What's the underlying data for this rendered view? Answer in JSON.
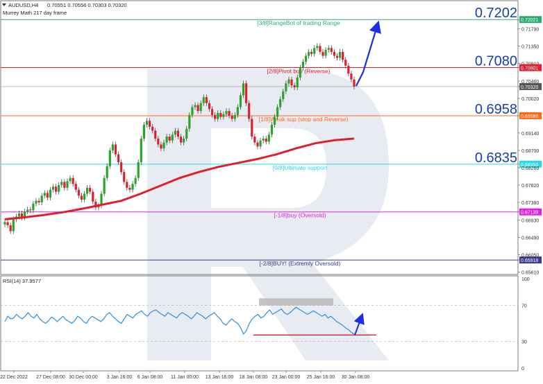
{
  "chart_data": {
    "type": "candlestick",
    "header": {
      "symbol": "AUDUSD,H4",
      "ohlc": "0.70551 0.70556 0.70303 0.70320",
      "indicator": "Murrey Math 217 day frame"
    },
    "ylim": [
      0.6555,
      0.725
    ],
    "y_ticks": [
      "0.72021",
      "0.71790",
      "0.71350",
      "0.70910",
      "0.70801",
      "0.70460",
      "0.70320",
      "0.70020",
      "0.69580",
      "0.69140",
      "0.68700",
      "0.68350",
      "0.68260",
      "0.67820",
      "0.67380",
      "0.67139",
      "0.66930",
      "0.66490",
      "0.66050",
      "0.65918",
      "0.65610"
    ],
    "highlight_ticks": {
      "0.72021": "#2eaa6e",
      "0.70801": "#e01e2d",
      "0.70320": "#555555",
      "0.69580": "#ff6a1a",
      "0.68350": "#2ad9e8",
      "0.67139": "#e020e0",
      "0.65918": "#3a3a8c"
    },
    "x_ticks": [
      "22 Dec 2022",
      "27 Dec 08:00",
      "30 Dec 00:00",
      "3 Jan 16:00",
      "6 Jan 08:00",
      "11 Jan 00:00",
      "13 Jan 16:00",
      "18 Jan 08:00",
      "23 Jan 00:00",
      "25 Jan 16:00",
      "30 Jan 08:00"
    ],
    "levels": [
      {
        "price": 0.72021,
        "color": "#2eaa6e",
        "label": "[3/8]RangeBot of trading Range",
        "big": "0.7202"
      },
      {
        "price": 0.70801,
        "color": "#e01e2d",
        "label": "[2/8]Pivot buy (Reverse)",
        "big": "0.7080"
      },
      {
        "price": 0.6958,
        "color": "#ff6a1a",
        "label": "[1/8]Weak sup (stop and Reverse)",
        "big": "0.6958"
      },
      {
        "price": 0.6835,
        "color": "#2ad9e8",
        "label": "[0/8]Ultimate support",
        "big": "0.6835"
      },
      {
        "price": 0.67139,
        "color": "#e020e0",
        "label": "[-1/8]buy (Oversold)",
        "big": ""
      },
      {
        "price": 0.65918,
        "color": "#3a3a8c",
        "label": "[-2/8]BUY! (Extremly Oversold)",
        "big": ""
      }
    ],
    "close_series": [
      0.6688,
      0.668,
      0.6665,
      0.6695,
      0.6702,
      0.671,
      0.67,
      0.6715,
      0.672,
      0.6718,
      0.6735,
      0.6742,
      0.6738,
      0.6755,
      0.6762,
      0.675,
      0.677,
      0.6778,
      0.6765,
      0.6782,
      0.679,
      0.6775,
      0.6792,
      0.68,
      0.6785,
      0.677,
      0.6755,
      0.6745,
      0.676,
      0.6775,
      0.6765,
      0.674,
      0.6725,
      0.673,
      0.676,
      0.68,
      0.683,
      0.687,
      0.6885,
      0.686,
      0.684,
      0.6815,
      0.679,
      0.6775,
      0.677,
      0.6785,
      0.68,
      0.684,
      0.69,
      0.6935,
      0.6945,
      0.693,
      0.692,
      0.69,
      0.6885,
      0.6875,
      0.689,
      0.6905,
      0.6895,
      0.691,
      0.692,
      0.6905,
      0.689,
      0.69,
      0.6925,
      0.696,
      0.698,
      0.6985,
      0.697,
      0.699,
      0.7005,
      0.699,
      0.6975,
      0.696,
      0.695,
      0.6965,
      0.6955,
      0.6962,
      0.697,
      0.6958,
      0.695,
      0.696,
      0.698,
      0.701,
      0.704,
      0.699,
      0.695,
      0.6905,
      0.689,
      0.688,
      0.6895,
      0.69,
      0.6892,
      0.691,
      0.6935,
      0.6955,
      0.698,
      0.7,
      0.702,
      0.704,
      0.705,
      0.7035,
      0.703,
      0.7055,
      0.708,
      0.7095,
      0.711,
      0.712,
      0.7115,
      0.713,
      0.7135,
      0.712,
      0.711,
      0.7125,
      0.713,
      0.712,
      0.711,
      0.7105,
      0.712,
      0.71,
      0.7085,
      0.7065,
      0.705,
      0.7032
    ],
    "ma_series": [
      0.6695,
      0.67,
      0.6706,
      0.6713,
      0.6722,
      0.6732,
      0.6742,
      0.676,
      0.678,
      0.68,
      0.6815,
      0.6828,
      0.6838,
      0.6848,
      0.686,
      0.6875,
      0.6888,
      0.6896,
      0.69
    ],
    "ma_color": "#e01e2d",
    "forecast_arrow_color": "#1a2ee8",
    "rsi": {
      "label": "RSI(14) 37.9577",
      "ylim": [
        0,
        100
      ],
      "ticks": [
        "100",
        "70",
        "30",
        "0"
      ],
      "series": [
        52,
        58,
        55,
        56,
        60,
        57,
        55,
        58,
        62,
        58,
        56,
        60,
        55,
        52,
        50,
        53,
        57,
        55,
        52,
        55,
        58,
        54,
        52,
        50,
        53,
        58,
        56,
        52,
        50,
        55,
        58,
        56,
        54,
        52,
        55,
        60,
        62,
        58,
        55,
        52,
        50,
        55,
        60,
        58,
        56,
        60,
        62,
        64,
        60,
        58,
        62,
        64,
        65,
        62,
        60,
        58,
        62,
        60,
        58,
        56,
        60,
        62,
        60,
        58,
        55,
        58,
        62,
        60,
        58,
        55,
        58,
        60,
        62,
        58,
        55,
        50,
        48,
        52,
        55,
        52,
        50,
        45,
        38,
        42,
        50,
        55,
        58,
        60,
        56,
        58,
        62,
        65,
        60,
        62,
        64,
        66,
        62,
        60,
        62,
        65,
        68,
        66,
        64,
        62,
        60,
        62,
        64,
        62,
        60,
        58,
        60,
        56,
        58,
        55,
        52,
        50,
        48,
        45,
        43,
        40,
        38
      ]
    }
  }
}
